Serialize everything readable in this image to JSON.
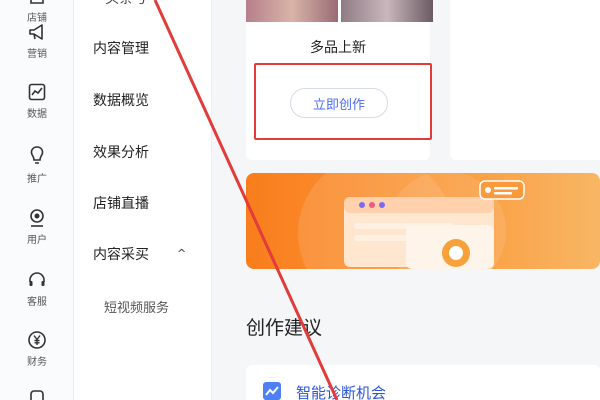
{
  "rail": {
    "items": [
      {
        "label": "店铺",
        "icon": "store-icon"
      },
      {
        "label": "营销",
        "icon": "megaphone-icon"
      },
      {
        "label": "数据",
        "icon": "chart-line-icon"
      },
      {
        "label": "推广",
        "icon": "lightbulb-icon"
      },
      {
        "label": "用户",
        "icon": "user-icon"
      },
      {
        "label": "客服",
        "icon": "headset-icon"
      },
      {
        "label": "财务",
        "icon": "yen-icon"
      }
    ]
  },
  "menu": {
    "partial_top": "头条号",
    "items": [
      "内容管理",
      "数据概览",
      "效果分析",
      "店铺直播",
      "内容采买"
    ],
    "chevron": "^",
    "sub_items": [
      "短视频服务"
    ]
  },
  "main": {
    "card_title": "多品上新",
    "create_button": "立即创作",
    "section_title": "创作建议",
    "suggestion_title": "智能诊断机会"
  },
  "colors": {
    "accent": "#4a6cf7",
    "highlight": "#e23b3b",
    "banner": "#f97d1c"
  }
}
